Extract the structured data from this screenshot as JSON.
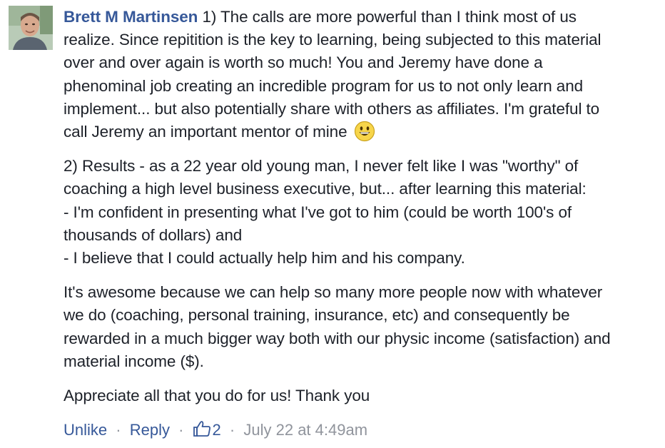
{
  "comment": {
    "author": "Brett M Martinsen",
    "avatar_icon": "user-avatar",
    "paragraphs": [
      [
        "1) The calls are more powerful than I think most of us",
        "realize. Since repitition is the key to learning, being subjected to this material",
        "over and over again is worth so much! You and Jeremy have done a",
        "phenominal job creating an incredible program for us to not only learn and",
        "implement... but also potentially share with others as affiliates. I'm grateful to",
        "call Jeremy an important mentor of mine"
      ],
      [
        "2) Results - as a 22 year old young man, I never felt like I was \"worthy\" of",
        "coaching a high level business executive, but... after learning this material:",
        "- I'm confident in presenting what I've got to him (could be worth 100's of",
        "thousands of dollars) and",
        "- I believe that I could actually help him and his company."
      ],
      [
        "It's awesome because we can help so many more people now with whatever",
        "we do (coaching, personal training, insurance, etc) and consequently be",
        "rewarded in a much bigger way both with our physic income (satisfaction) and",
        "material income ($)."
      ],
      [
        "Appreciate all that you do for us! Thank you"
      ]
    ],
    "emoji_icon": "smiley-emoji-icon"
  },
  "actions": {
    "unlike": "Unlike",
    "reply": "Reply",
    "separator": "·",
    "like_count": "2",
    "timestamp": "July 22 at 4:49am",
    "like_icon": "thumbs-up-icon"
  },
  "colors": {
    "link": "#365899",
    "text": "#1d2129",
    "muted": "#90949c"
  }
}
